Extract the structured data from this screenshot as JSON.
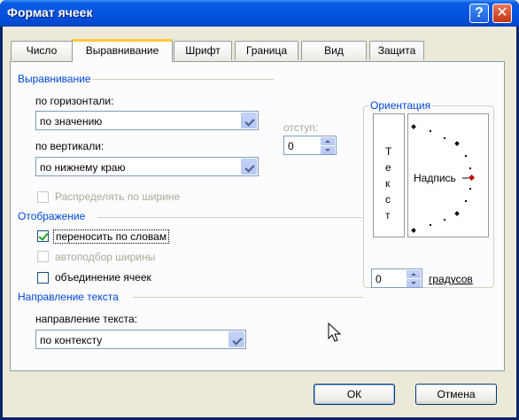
{
  "window": {
    "title": "Формат ячеек",
    "help_glyph": "?",
    "close_glyph": "✕"
  },
  "tabs": [
    {
      "label": "Число"
    },
    {
      "label": "Выравнивание",
      "active": true
    },
    {
      "label": "Шрифт"
    },
    {
      "label": "Граница"
    },
    {
      "label": "Вид"
    },
    {
      "label": "Защита"
    }
  ],
  "alignment": {
    "group_label": "Выравнивание",
    "horizontal_label": "по горизонтали:",
    "horizontal_value": "по значению",
    "vertical_label": "по вертикали:",
    "vertical_value": "по нижнему краю",
    "indent_label": "отступ:",
    "indent_value": "0",
    "distribute_label": "Распределять по ширине"
  },
  "display": {
    "group_label": "Отображение",
    "wrap_label": "переносить по словам",
    "wrap_checked": true,
    "shrink_label": "автоподбор ширины",
    "shrink_enabled": false,
    "merge_label": "объединение ячеек",
    "merge_checked": false
  },
  "direction": {
    "group_label": "Направление текста",
    "label": "направление текста:",
    "value": "по контексту"
  },
  "orientation": {
    "group_label": "Ориентация",
    "vertical_text": [
      "Т",
      "е",
      "к",
      "с",
      "т"
    ],
    "dial_label": "Надпись",
    "degrees_value": "0",
    "degrees_label": "градусов"
  },
  "buttons": {
    "ok": "ОК",
    "cancel": "Отмена"
  },
  "colors": {
    "title_bar": "#0554e0",
    "group_label": "#0046d5",
    "tab_highlight": "#ffc83c",
    "check": "#21a121",
    "dial_active": "#c00000"
  },
  "icons": {
    "help": "question-icon",
    "close": "close-icon",
    "cursor": "mouse-cursor-icon"
  }
}
